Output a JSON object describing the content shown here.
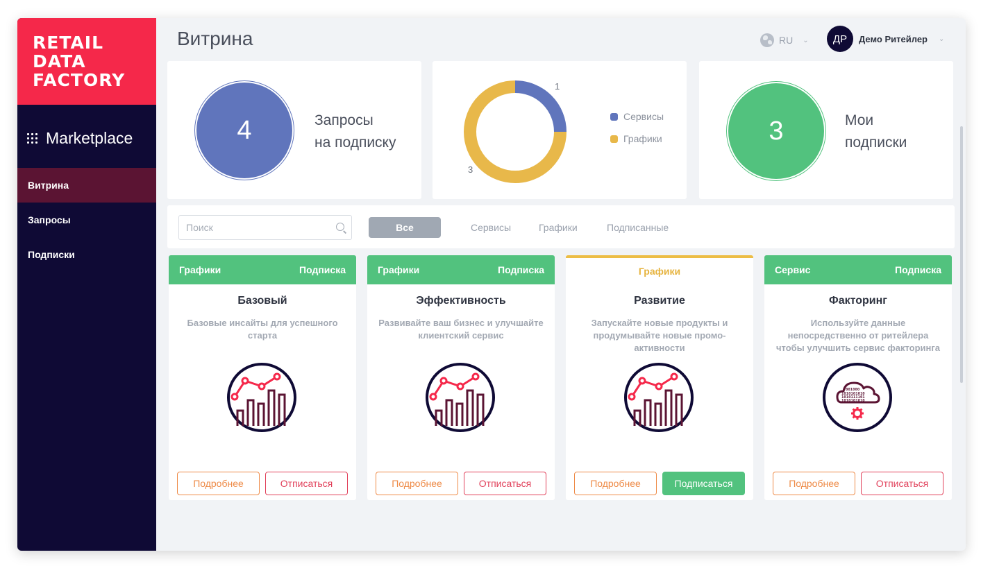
{
  "brand": {
    "logo_lines": [
      "RETAIL",
      "DATA",
      "FACTORY"
    ],
    "app_name": "Marketplace"
  },
  "nav": [
    {
      "label": "Витрина",
      "active": true
    },
    {
      "label": "Запросы",
      "active": false
    },
    {
      "label": "Подписки",
      "active": false
    }
  ],
  "header": {
    "title": "Витрина",
    "language": "RU",
    "user_initials": "ДР",
    "user_name": "Демо Ритейлер"
  },
  "stats": {
    "requests": {
      "value": "4",
      "label_line1": "Запросы",
      "label_line2": "на подписку"
    },
    "chart": {
      "legend": [
        {
          "label": "Сервисы",
          "color": "#6075bc"
        },
        {
          "label": "Графики",
          "color": "#e8b84a"
        }
      ]
    },
    "subscriptions": {
      "value": "3",
      "label_line1": "Мои",
      "label_line2": "подписки"
    }
  },
  "chart_data": {
    "type": "pie",
    "categories": [
      "Сервисы",
      "Графики"
    ],
    "values": [
      1,
      3
    ],
    "data_labels": [
      "1",
      "3"
    ],
    "colors": [
      "#6075bc",
      "#e8b84a"
    ],
    "donut": true,
    "legend_position": "right"
  },
  "filter": {
    "search_placeholder": "Поиск",
    "tabs": [
      "Все",
      "Сервисы",
      "Графики",
      "Подписанные"
    ],
    "active_tab": "Все"
  },
  "cards": [
    {
      "category": "Графики",
      "status": "Подписка",
      "title": "Базовый",
      "description": "Базовые инсайты для успешного старта",
      "icon": "chart-growth-icon",
      "more_label": "Подробнее",
      "action_label": "Отписаться"
    },
    {
      "category": "Графики",
      "status": "Подписка",
      "title": "Эффективность",
      "description": "Развивайте ваш бизнес и улучшайте клиентский сервис",
      "icon": "chart-growth-icon",
      "more_label": "Подробнее",
      "action_label": "Отписаться"
    },
    {
      "category": "Графики",
      "status": "",
      "title": "Развитие",
      "description": "Запускайте новые продукты и продумывайте новые промо-активности",
      "icon": "chart-growth-icon",
      "more_label": "Подробнее",
      "action_label": "Подписаться"
    },
    {
      "category": "Сервис",
      "status": "Подписка",
      "title": "Факторинг",
      "description": "Используйте данные непосредственно от ритейлера чтобы улучшить сервис факторинга",
      "icon": "cloud-data-icon",
      "more_label": "Подробнее",
      "action_label": "Отписаться"
    }
  ]
}
